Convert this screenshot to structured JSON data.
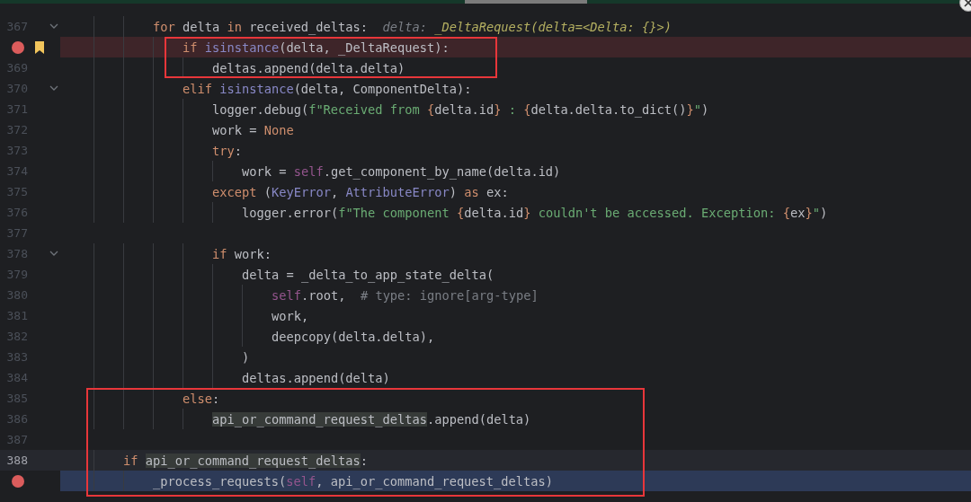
{
  "editor": {
    "lines": [
      {
        "number": "367",
        "tokens": [
          {
            "text": "            for",
            "kind": "keyword"
          },
          {
            "text": " delta ",
            "kind": "plain"
          },
          {
            "text": "in",
            "kind": "keyword"
          },
          {
            "text": " received_deltas:  ",
            "kind": "plain"
          },
          {
            "text": "delta: ",
            "kind": "hint-name"
          },
          {
            "text": "_DeltaRequest(delta=<Delta: {}>)",
            "kind": "hint"
          }
        ],
        "breakpoint": false,
        "bookmark": false,
        "fold": true,
        "current": false,
        "caret": false
      },
      {
        "tokens": [
          {
            "text": "                if",
            "kind": "keyword"
          },
          {
            "text": " isinstance",
            "kind": "builtin"
          },
          {
            "text": "(delta, _DeltaRequest):",
            "kind": "plain"
          }
        ],
        "breakpoint": true,
        "bookmark": true,
        "fold": false,
        "current": false,
        "caret": false
      },
      {
        "number": "369",
        "tokens": [
          {
            "text": "                    deltas.append(delta.delta)",
            "kind": "plain"
          }
        ],
        "breakpoint": false,
        "bookmark": false,
        "fold": false,
        "current": false,
        "caret": false
      },
      {
        "number": "370",
        "tokens": [
          {
            "text": "                elif",
            "kind": "keyword"
          },
          {
            "text": " isinstance",
            "kind": "builtin"
          },
          {
            "text": "(delta, ComponentDelta):",
            "kind": "plain"
          }
        ],
        "breakpoint": false,
        "bookmark": false,
        "fold": true,
        "current": false,
        "caret": false
      },
      {
        "number": "371",
        "tokens": [
          {
            "text": "                    logger.debug(",
            "kind": "plain"
          },
          {
            "text": "f\"Received from ",
            "kind": "string"
          },
          {
            "text": "{",
            "kind": "keyword"
          },
          {
            "text": "delta.id",
            "kind": "plain"
          },
          {
            "text": "}",
            "kind": "keyword"
          },
          {
            "text": " : ",
            "kind": "string"
          },
          {
            "text": "{",
            "kind": "keyword"
          },
          {
            "text": "delta.delta.to_dict()",
            "kind": "plain"
          },
          {
            "text": "}",
            "kind": "keyword"
          },
          {
            "text": "\"",
            "kind": "string"
          },
          {
            "text": ")",
            "kind": "plain"
          }
        ],
        "breakpoint": false,
        "bookmark": false,
        "fold": false,
        "current": false,
        "caret": false
      },
      {
        "number": "372",
        "tokens": [
          {
            "text": "                    work = ",
            "kind": "plain"
          },
          {
            "text": "None",
            "kind": "keyword"
          }
        ],
        "breakpoint": false,
        "bookmark": false,
        "fold": false,
        "current": false,
        "caret": false
      },
      {
        "number": "373",
        "tokens": [
          {
            "text": "                    try",
            "kind": "keyword"
          },
          {
            "text": ":",
            "kind": "plain"
          }
        ],
        "breakpoint": false,
        "bookmark": false,
        "fold": false,
        "current": false,
        "caret": false
      },
      {
        "number": "374",
        "tokens": [
          {
            "text": "                        work = ",
            "kind": "plain"
          },
          {
            "text": "self",
            "kind": "self"
          },
          {
            "text": ".get_component_by_name(delta.id)",
            "kind": "plain"
          }
        ],
        "breakpoint": false,
        "bookmark": false,
        "fold": false,
        "current": false,
        "caret": false
      },
      {
        "number": "375",
        "tokens": [
          {
            "text": "                    except",
            "kind": "keyword"
          },
          {
            "text": " (",
            "kind": "plain"
          },
          {
            "text": "KeyError",
            "kind": "builtin"
          },
          {
            "text": ", ",
            "kind": "plain"
          },
          {
            "text": "AttributeError",
            "kind": "builtin"
          },
          {
            "text": ") ",
            "kind": "plain"
          },
          {
            "text": "as",
            "kind": "keyword"
          },
          {
            "text": " ex:",
            "kind": "plain"
          }
        ],
        "breakpoint": false,
        "bookmark": false,
        "fold": false,
        "current": false,
        "caret": false
      },
      {
        "number": "376",
        "tokens": [
          {
            "text": "                        logger.error(",
            "kind": "plain"
          },
          {
            "text": "f\"The component ",
            "kind": "string"
          },
          {
            "text": "{",
            "kind": "keyword"
          },
          {
            "text": "delta.id",
            "kind": "plain"
          },
          {
            "text": "}",
            "kind": "keyword"
          },
          {
            "text": " couldn't be accessed. Exception: ",
            "kind": "string"
          },
          {
            "text": "{",
            "kind": "keyword"
          },
          {
            "text": "ex",
            "kind": "plain"
          },
          {
            "text": "}",
            "kind": "keyword"
          },
          {
            "text": "\"",
            "kind": "string"
          },
          {
            "text": ")",
            "kind": "plain"
          }
        ],
        "breakpoint": false,
        "bookmark": false,
        "fold": false,
        "current": false,
        "caret": false
      },
      {
        "number": "377",
        "breakpoint": false,
        "bookmark": false,
        "fold": false,
        "current": false,
        "caret": false
      },
      {
        "number": "378",
        "tokens": [
          {
            "text": "                    if",
            "kind": "keyword"
          },
          {
            "text": " work:",
            "kind": "plain"
          }
        ],
        "breakpoint": false,
        "bookmark": false,
        "fold": true,
        "current": false,
        "caret": false
      },
      {
        "number": "379",
        "tokens": [
          {
            "text": "                        delta = _delta_to_app_state_delta(",
            "kind": "plain"
          }
        ],
        "breakpoint": false,
        "bookmark": false,
        "fold": false,
        "current": false,
        "caret": false
      },
      {
        "number": "380",
        "tokens": [
          {
            "text": "                            self",
            "kind": "self"
          },
          {
            "text": ".root,  ",
            "kind": "plain"
          },
          {
            "text": "# type: ignore[arg-type]",
            "kind": "comment"
          }
        ],
        "breakpoint": false,
        "bookmark": false,
        "fold": false,
        "current": false,
        "caret": false
      },
      {
        "number": "381",
        "tokens": [
          {
            "text": "                            work,",
            "kind": "plain"
          }
        ],
        "breakpoint": false,
        "bookmark": false,
        "fold": false,
        "current": false,
        "caret": false
      },
      {
        "number": "382",
        "tokens": [
          {
            "text": "                            deepcopy(delta.delta),",
            "kind": "plain"
          }
        ],
        "breakpoint": false,
        "bookmark": false,
        "fold": false,
        "current": false,
        "caret": false
      },
      {
        "number": "383",
        "tokens": [
          {
            "text": "                        )",
            "kind": "plain"
          }
        ],
        "breakpoint": false,
        "bookmark": false,
        "fold": false,
        "current": false,
        "caret": false
      },
      {
        "number": "384",
        "tokens": [
          {
            "text": "                        deltas.append(delta)",
            "kind": "plain"
          }
        ],
        "breakpoint": false,
        "bookmark": false,
        "fold": false,
        "current": false,
        "caret": false
      },
      {
        "number": "385",
        "tokens": [
          {
            "text": "                else",
            "kind": "keyword"
          },
          {
            "text": ":",
            "kind": "plain"
          }
        ],
        "breakpoint": false,
        "bookmark": false,
        "fold": false,
        "current": false,
        "caret": false
      },
      {
        "number": "386",
        "tokens": [
          {
            "text": "                    api_or_command_request_deltas",
            "kind": "usage"
          },
          {
            "text": ".append(delta)",
            "kind": "plain"
          }
        ],
        "breakpoint": false,
        "bookmark": false,
        "fold": false,
        "current": false,
        "caret": false
      },
      {
        "number": "387",
        "breakpoint": false,
        "bookmark": false,
        "fold": false,
        "current": false,
        "caret": false
      },
      {
        "number": "388",
        "tokens": [
          {
            "text": "        if",
            "kind": "keyword"
          },
          {
            "text": " api_or_command_request_deltas",
            "kind": "usage"
          },
          {
            "text": ":",
            "kind": "plain"
          }
        ],
        "breakpoint": false,
        "bookmark": false,
        "fold": false,
        "current": false,
        "caret": true
      },
      {
        "tokens": [
          {
            "text": "            _process_requests(",
            "kind": "plain"
          },
          {
            "text": "self",
            "kind": "self"
          },
          {
            "text": ", api_or_command_request_deltas)",
            "kind": "plain"
          }
        ],
        "breakpoint": true,
        "bookmark": false,
        "fold": false,
        "current": true,
        "caret": false
      }
    ]
  }
}
